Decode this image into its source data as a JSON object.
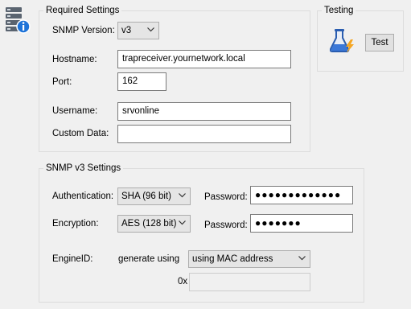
{
  "icon": {
    "server": "server-info-icon",
    "flask": "flask-lightning-icon"
  },
  "required": {
    "title": "Required Settings",
    "snmp_version": {
      "label": "SNMP Version:",
      "value": "v3"
    },
    "hostname": {
      "label": "Hostname:",
      "value": "trapreceiver.yournetwork.local"
    },
    "port": {
      "label": "Port:",
      "value": "162"
    },
    "username": {
      "label": "Username:",
      "value": "srvonline"
    },
    "custom_data": {
      "label": "Custom Data:",
      "value": ""
    }
  },
  "testing": {
    "title": "Testing",
    "button": "Test"
  },
  "v3": {
    "title": "SNMP v3 Settings",
    "authentication": {
      "label": "Authentication:",
      "value": "SHA (96 bit)",
      "password_label": "Password:",
      "password": "●●●●●●●●●●●●●"
    },
    "encryption": {
      "label": "Encryption:",
      "value": "AES (128 bit)",
      "password_label": "Password:",
      "password": "●●●●●●●"
    },
    "engine": {
      "label": "EngineID:",
      "generate_label": "generate using",
      "value": "using MAC address",
      "prefix": "0x",
      "hex_value": ""
    }
  }
}
